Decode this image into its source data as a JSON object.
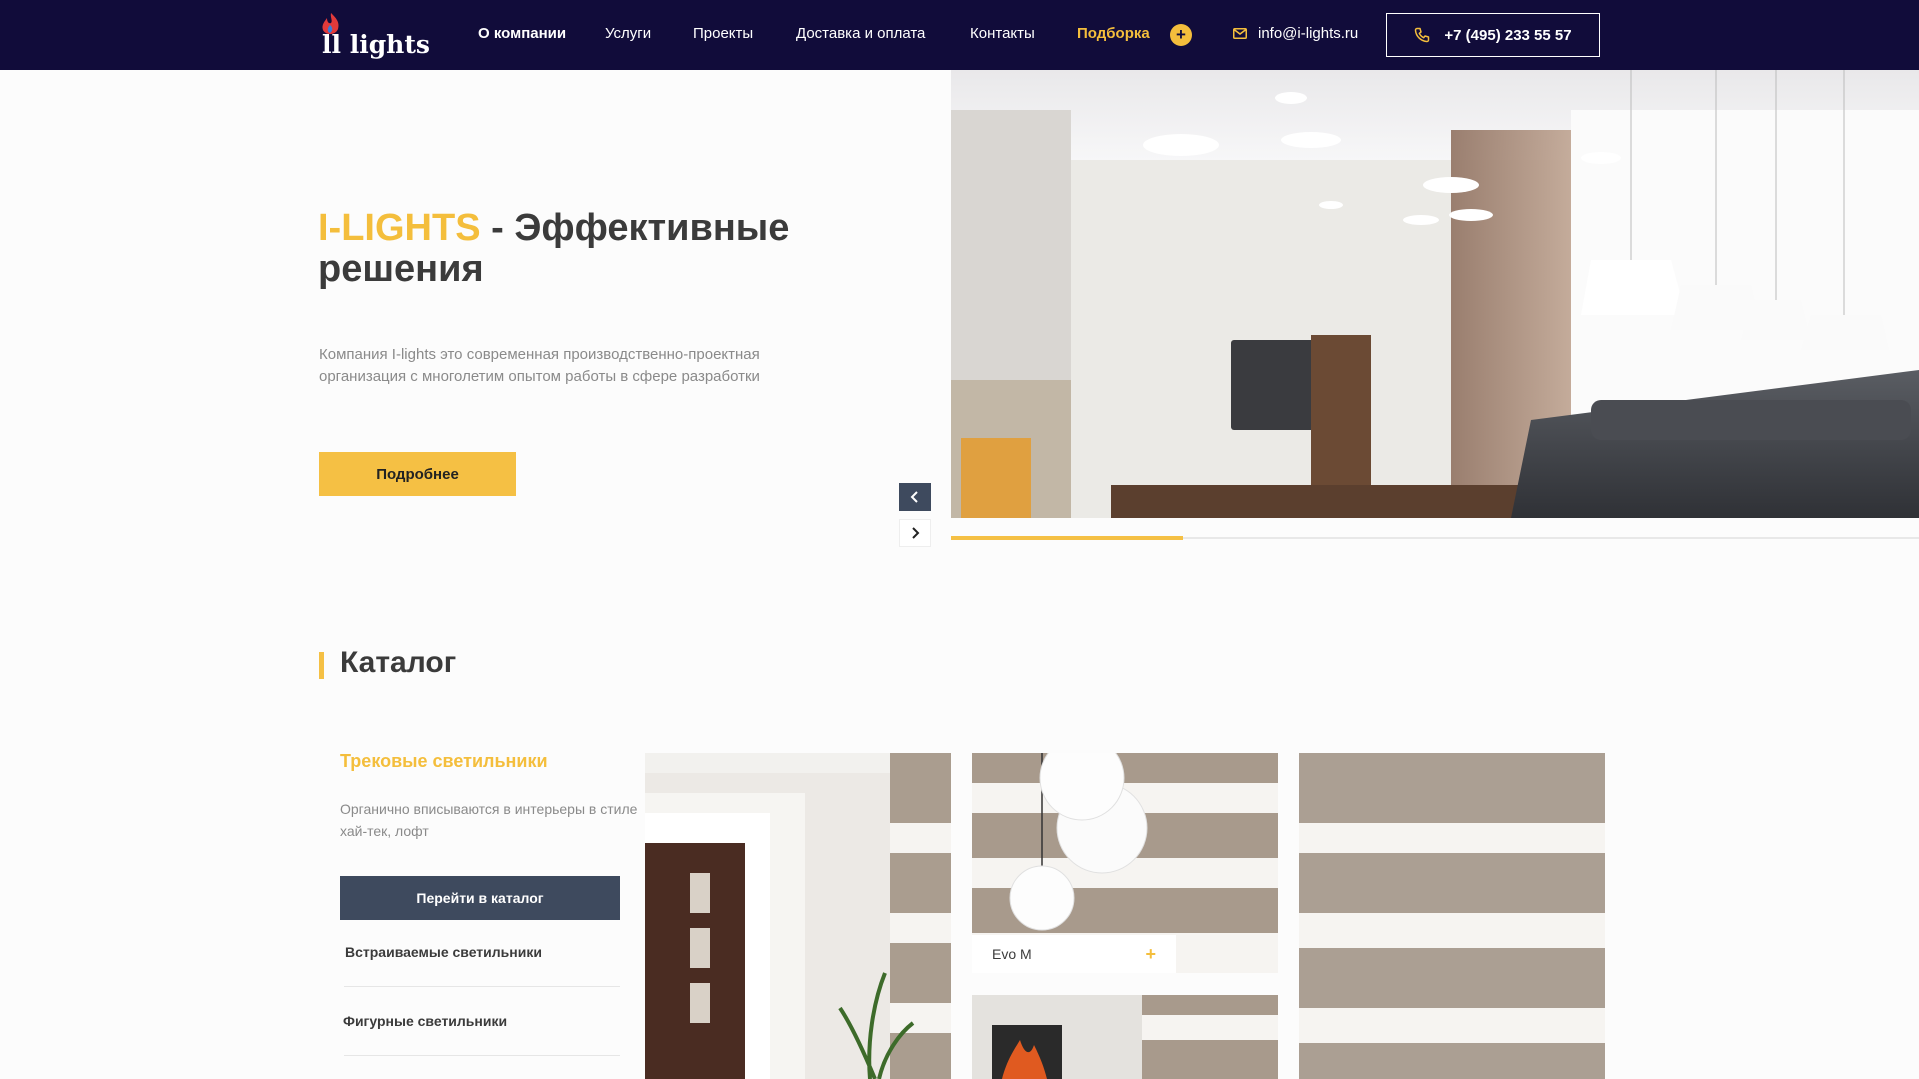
{
  "header": {
    "logo_text": "ll lights",
    "nav": [
      {
        "label": "О компании"
      },
      {
        "label": "Услуги"
      },
      {
        "label": "Проекты"
      },
      {
        "label": "Доставка и оплата"
      },
      {
        "label": "Контакты"
      },
      {
        "label": "Подборка"
      }
    ],
    "plus_symbol": "+",
    "email": "info@i-lights.ru",
    "phone": "+7 (495)  233 55 57",
    "icons": [
      "flame-logo-icon",
      "plus-icon",
      "mail-icon",
      "phone-icon"
    ]
  },
  "hero": {
    "title_brand": "I-LIGHTS",
    "title_rest": " - Эффективные решения",
    "text": "Компания I-lights это современная производственно-проектная организация с многолетим опытом работы в сфере разработки",
    "button": "Подробнее",
    "prev_icon": "chevron-left-icon",
    "next_icon": "chevron-right-icon",
    "slider_progress": 0.24
  },
  "catalog": {
    "title": "Каталог",
    "active_category": "Трековые светильники",
    "active_desc": "Органично вписываются в интерьеры в стиле хай-тек, лофт",
    "button": "Перейти в каталог",
    "categories": [
      {
        "label": "Встраиваемые светильники"
      },
      {
        "label": "Фигурные светильники"
      }
    ],
    "card_label": "Evo M",
    "card_plus": "+"
  },
  "colors": {
    "header_bg": "#110c3a",
    "accent": "#f4be3c",
    "dark_button": "#3e4a5e"
  }
}
